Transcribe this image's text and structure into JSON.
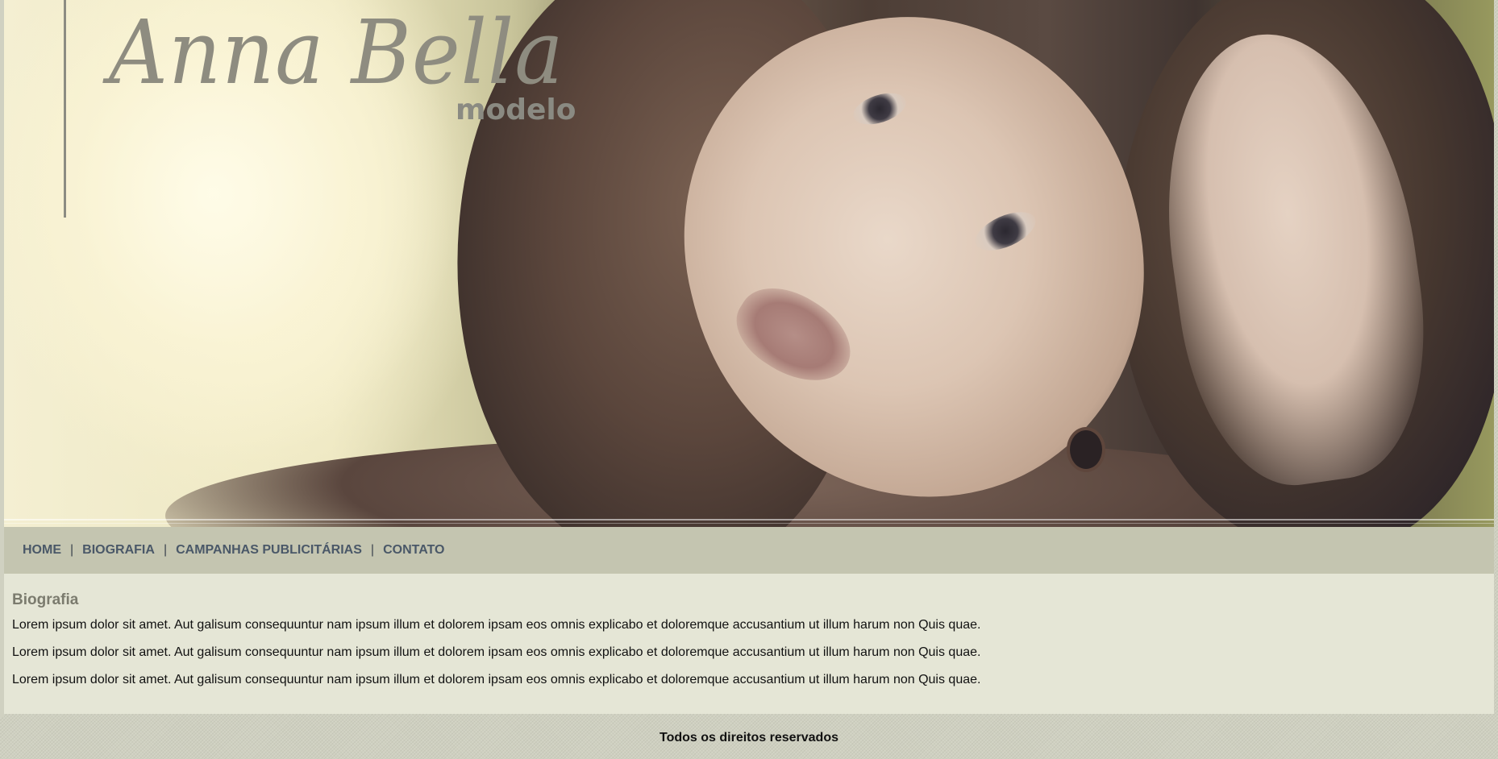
{
  "hero": {
    "logo_name": "Anna Bella",
    "logo_sub": "modelo"
  },
  "nav": {
    "items": [
      {
        "label": "HOME"
      },
      {
        "label": "BIOGRAFIA"
      },
      {
        "label": "CAMPANHAS PUBLICITÁRIAS"
      },
      {
        "label": "CONTATO"
      }
    ],
    "separator": "|"
  },
  "content": {
    "title": "Biografia",
    "paragraphs": [
      "Lorem ipsum dolor sit amet. Aut galisum consequuntur nam ipsum illum et dolorem ipsam eos omnis explicabo et doloremque accusantium ut illum harum non Quis quae.",
      "Lorem ipsum dolor sit amet. Aut galisum consequuntur nam ipsum illum et dolorem ipsam eos omnis explicabo et doloremque accusantium ut illum harum non Quis quae.",
      "Lorem ipsum dolor sit amet. Aut galisum consequuntur nam ipsum illum et dolorem ipsam eos omnis explicabo et doloremque accusantium ut illum harum non Quis quae."
    ]
  },
  "footer": {
    "text": "Todos os direitos reservados"
  },
  "colors": {
    "nav_bg": "#c4c5b0",
    "nav_text": "#4a5868",
    "content_bg": "#e5e6d6",
    "title_text": "#7b7b6e",
    "page_bg": "#cfd0c0"
  }
}
